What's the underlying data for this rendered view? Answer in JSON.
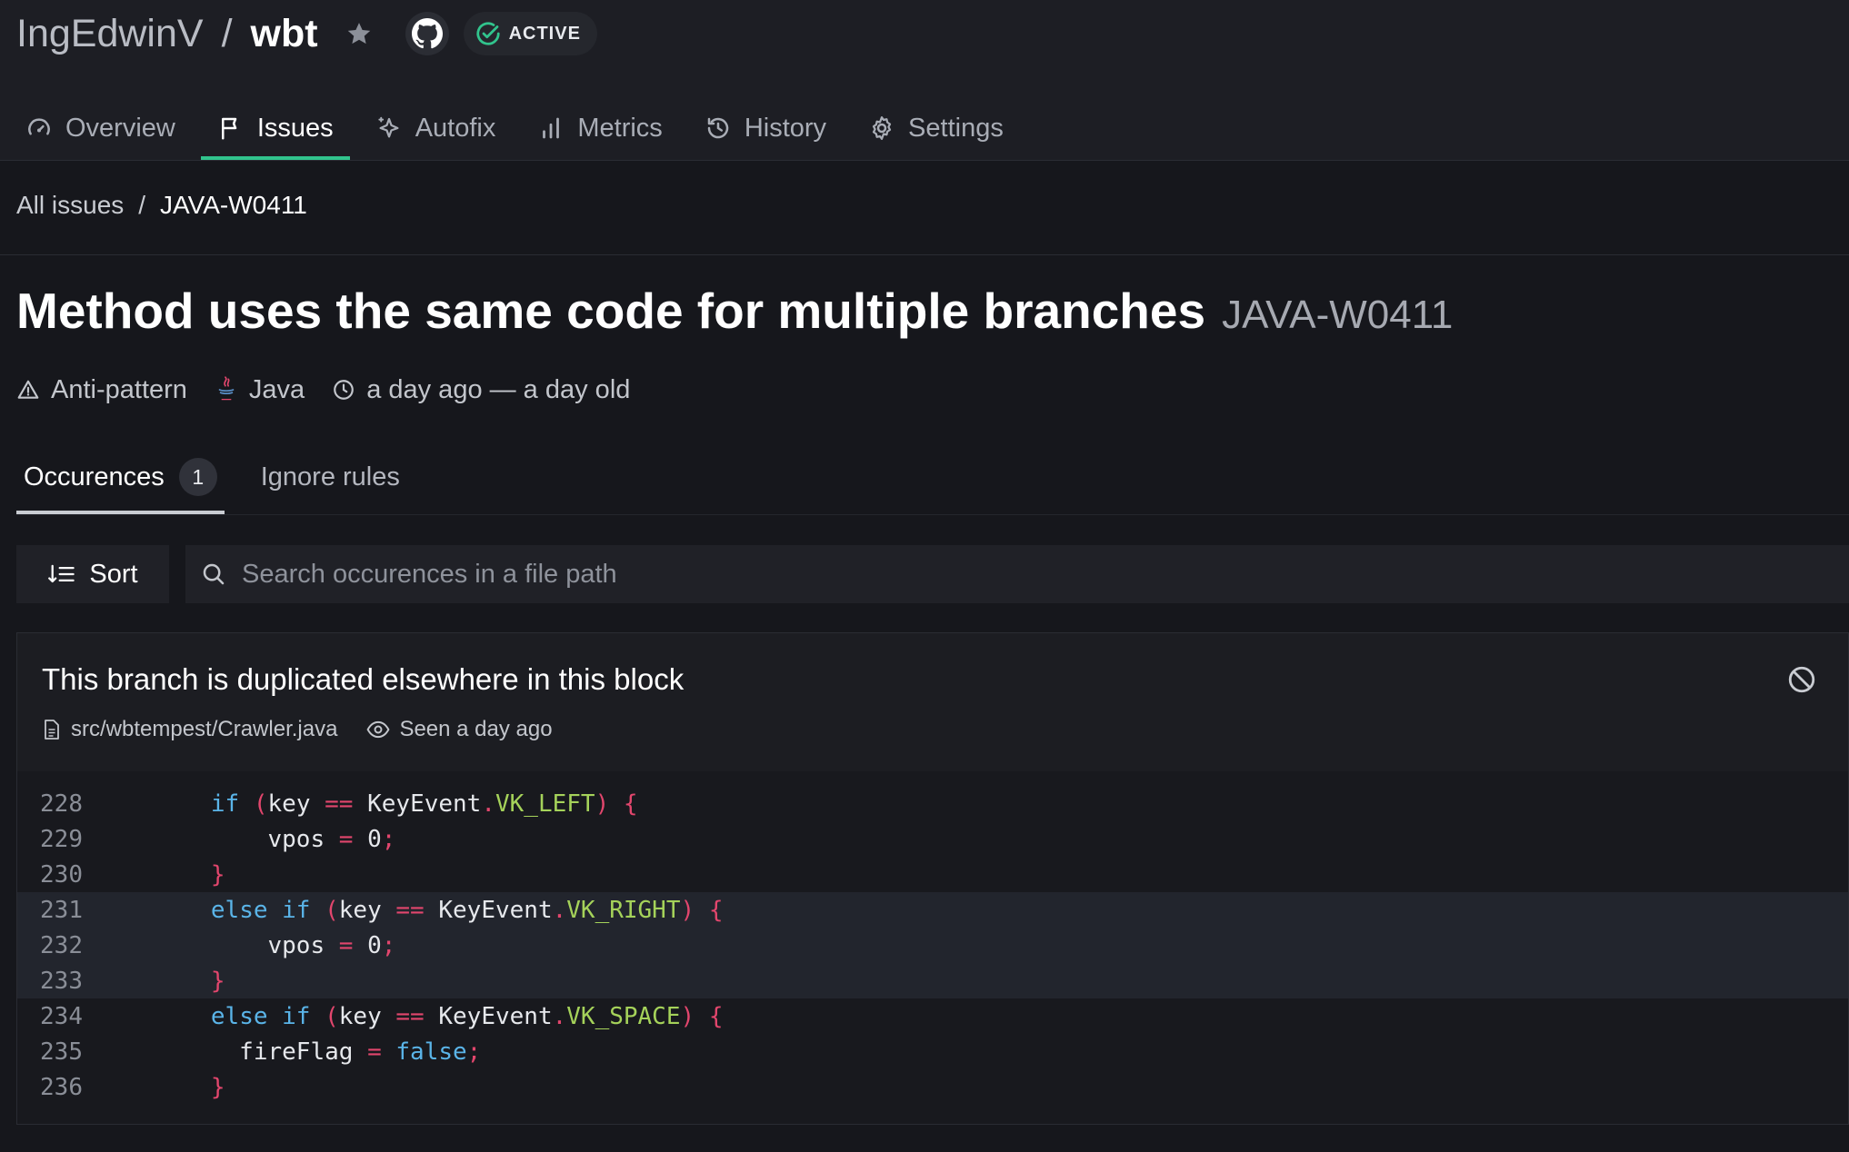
{
  "repo": {
    "owner": "IngEdwinV",
    "separator": "/",
    "name": "wbt",
    "status": "ACTIVE"
  },
  "nav": {
    "tabs": [
      {
        "label": "Overview",
        "icon": "gauge-icon",
        "active": false
      },
      {
        "label": "Issues",
        "icon": "flag-icon",
        "active": true
      },
      {
        "label": "Autofix",
        "icon": "sparkle-icon",
        "active": false
      },
      {
        "label": "Metrics",
        "icon": "bar-chart-icon",
        "active": false
      },
      {
        "label": "History",
        "icon": "history-icon",
        "active": false
      },
      {
        "label": "Settings",
        "icon": "gear-icon",
        "active": false
      }
    ]
  },
  "breadcrumb": {
    "parent": "All issues",
    "separator": "/",
    "current": "JAVA-W0411"
  },
  "issue": {
    "title": "Method uses the same code for multiple branches",
    "code": "JAVA-W0411",
    "category": "Anti-pattern",
    "language": "Java",
    "age": "a day ago — a day old"
  },
  "subtabs": {
    "occurrences_label": "Occurences",
    "occurrences_count": "1",
    "ignore_label": "Ignore rules"
  },
  "toolbar": {
    "sort_label": "Sort",
    "search_placeholder": "Search occurences in a file path"
  },
  "occurrence": {
    "message": "This branch is duplicated elsewhere in this block",
    "file": "src/wbtempest/Crawler.java",
    "seen": "Seen a day ago",
    "code_lines": [
      {
        "number": "228",
        "highlight": false,
        "text": "        if (key == KeyEvent.VK_LEFT) {"
      },
      {
        "number": "229",
        "highlight": false,
        "text": "            vpos = 0;"
      },
      {
        "number": "230",
        "highlight": false,
        "text": "        }"
      },
      {
        "number": "231",
        "highlight": true,
        "text": "        else if (key == KeyEvent.VK_RIGHT) {"
      },
      {
        "number": "232",
        "highlight": true,
        "text": "            vpos = 0;"
      },
      {
        "number": "233",
        "highlight": true,
        "text": "        }"
      },
      {
        "number": "234",
        "highlight": false,
        "text": "        else if (key == KeyEvent.VK_SPACE) {"
      },
      {
        "number": "235",
        "highlight": false,
        "text": "          fireFlag = false;"
      },
      {
        "number": "236",
        "highlight": false,
        "text": "        }"
      }
    ]
  },
  "colors": {
    "accent": "#31c48d",
    "keyword": "#5ab4e8",
    "operator": "#e2466d",
    "field": "#a5d25a"
  }
}
